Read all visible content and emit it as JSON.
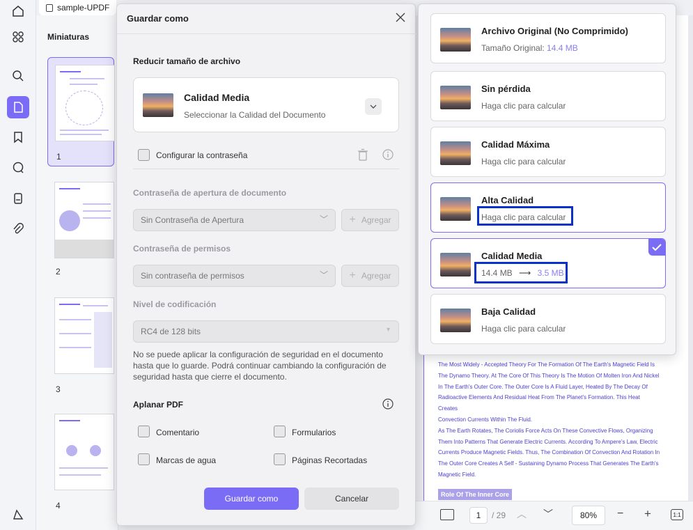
{
  "tab": {
    "title": "sample-UPDF"
  },
  "thumbnails": {
    "title": "Miniaturas",
    "pages": [
      "1",
      "2",
      "3",
      "4"
    ]
  },
  "dialog": {
    "title": "Guardar como",
    "reduce_section": "Reducir tamaño de archivo",
    "quality_title": "Calidad Media",
    "quality_sub": "Seleccionar la Calidad del Documento",
    "password_checkbox": "Configurar la contraseña",
    "open_password_label": "Contraseña de apertura de documento",
    "open_password_value": "Sin Contraseña de Apertura",
    "add_label": "Agregar",
    "permissions_label": "Contraseña de permisos",
    "permissions_value": "Sin contraseña de permisos",
    "encryption_label": "Nivel de codificación",
    "encryption_value": "RC4 de 128 bits",
    "note": "No se puede aplicar la configuración de seguridad en el documento hasta que lo guarde. Podrá continuar cambiando la configuración de seguridad hasta que cierre el documento.",
    "flatten_section": "Aplanar PDF",
    "flatten_options": [
      "Comentario",
      "Formularios",
      "Marcas de agua",
      "Páginas Recortadas"
    ],
    "save_button": "Guardar como",
    "cancel_button": "Cancelar"
  },
  "quality_options": [
    {
      "title": "Archivo Original (No Comprimido)",
      "sub_prefix": "Tamaño Original: ",
      "sub_value": "14.4 MB"
    },
    {
      "title": "Sin pérdida",
      "sub": "Haga clic para calcular"
    },
    {
      "title": "Calidad Máxima",
      "sub": "Haga clic para calcular"
    },
    {
      "title": "Alta Calidad",
      "sub": "Haga clic para calcular"
    },
    {
      "title": "Calidad Media",
      "size_from": "14.4 MB",
      "size_to": "3.5 MB",
      "selected": true
    },
    {
      "title": "Baja Calidad",
      "sub": "Haga clic para calcular"
    }
  ],
  "document": {
    "lines": [
      "The Most Widely - Accepted Theory For The Formation Of The Earth's Magnetic Field Is",
      "The Dynamo Theory. At The Core Of This Theory Is The Motion Of Molten Iron And Nickel",
      "In The Earth's Outer Core. The Outer Core Is A Fluid Layer, Heated By The Decay Of",
      "Radioactive Elements And Residual Heat From The Planet's Formation. This Heat Creates",
      "Convection Currents Within The Fluid.",
      "As The Earth Rotates, The Coriolis Force Acts On These Convective Flows, Organizing",
      "Them Into Patterns That Generate Electric Currents. According To Ampere's Law, Electric",
      "Currents Produce Magnetic Fields. Thus, The Combination Of Convection And Rotation In",
      "The Outer Core Creates A Self - Sustaining Dynamo Process That Generates The Earth's",
      "Magnetic Field."
    ],
    "heading": "Role Of The Inner Core"
  },
  "bottom_bar": {
    "page": "1",
    "total": "/ 29",
    "zoom": "80%",
    "fit": "1:1"
  },
  "colors": {
    "accent": "#7b6cf6",
    "highlight": "#0a31c9"
  }
}
